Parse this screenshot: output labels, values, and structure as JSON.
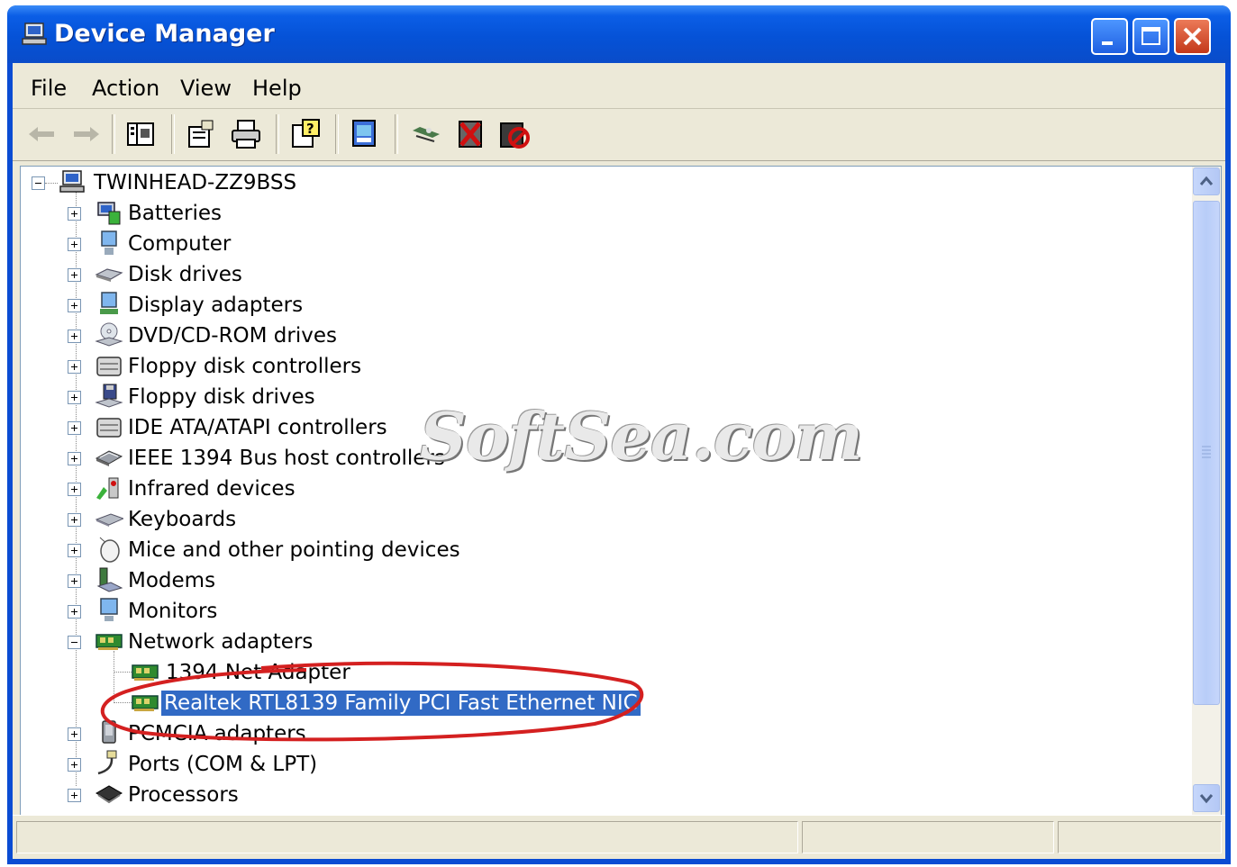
{
  "window": {
    "title": "Device Manager",
    "title_icon": "computer-manager-icon"
  },
  "menu": [
    "File",
    "Action",
    "View",
    "Help"
  ],
  "toolbar": {
    "buttons": [
      "back-arrow-icon",
      "forward-arrow-icon",
      "show-hide-tree-icon",
      "properties-icon",
      "print-icon",
      "help-icon",
      "update-driver-icon",
      "scan-hardware-icon",
      "uninstall-icon",
      "disable-icon"
    ]
  },
  "tree": {
    "root": "TWINHEAD-ZZ9BSS",
    "categories": [
      "Batteries",
      "Computer",
      "Disk drives",
      "Display adapters",
      "DVD/CD-ROM drives",
      "Floppy disk controllers",
      "Floppy disk drives",
      "IDE ATA/ATAPI controllers",
      "IEEE 1394 Bus host controllers",
      "Infrared devices",
      "Keyboards",
      "Mice and other pointing devices",
      "Modems",
      "Monitors",
      "Network adapters",
      "1394 Net Adapter",
      "Realtek RTL8139 Family PCI Fast Ethernet NIC",
      "PCMCIA adapters",
      "Ports (COM & LPT)",
      "Processors"
    ],
    "selected": "Realtek RTL8139 Family PCI Fast Ethernet NIC"
  },
  "watermark": "SoftSea.com",
  "colors": {
    "titlebar": "#0552d7",
    "selection": "#316ac5",
    "annotation": "#d42020",
    "chrome": "#ece9d8"
  }
}
